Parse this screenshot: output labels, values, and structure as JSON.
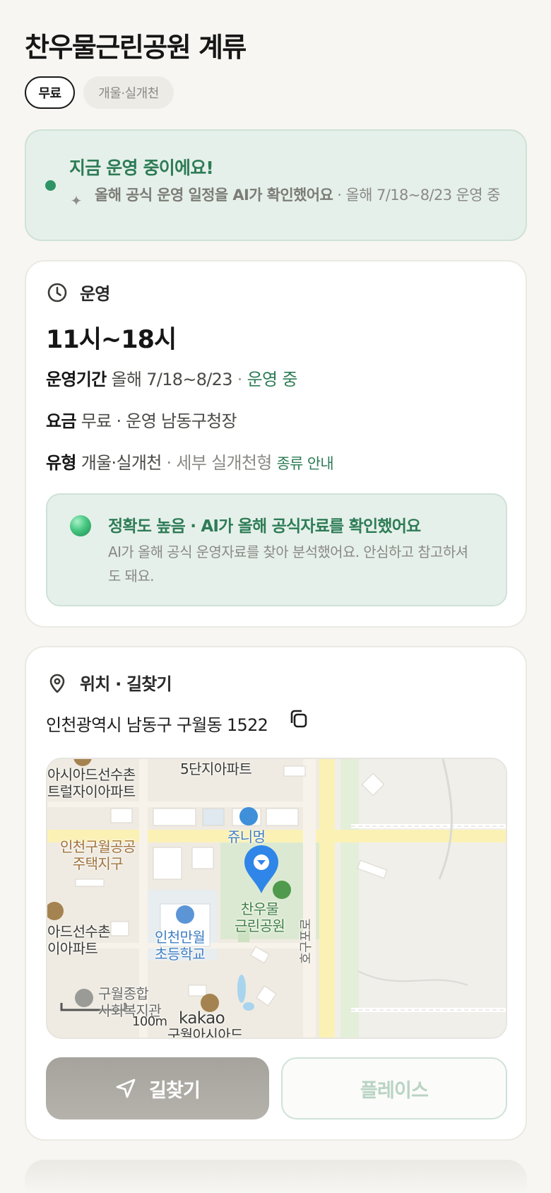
{
  "header": {
    "title": "찬우물근린공원 계류",
    "chips": {
      "price": "무료",
      "type": "개울·실개천"
    }
  },
  "status": {
    "title": "지금 운영 중이에요!",
    "ai_note": "올해 공식 운영 일정을 AI가 확인했어요",
    "period_note": " · 올해 7/18~8/23 운영 중",
    "icon": "sparkle-icon",
    "dot_color": "#2f9465"
  },
  "hours_section": {
    "heading": "운영",
    "icon": "clock-icon",
    "hours": "11시~18시",
    "period_key": "운영기간",
    "period_value": "올해 7/18~8/23",
    "period_sep": " · ",
    "period_status": "운영 중",
    "fee_key": "요금",
    "fee_value": "무료 · 운영 남동구청장",
    "type_key": "유형",
    "type_value": "개울·실개천",
    "type_detail": " · 세부 실개천형 ",
    "type_link": "종류 안내",
    "accuracy_title": "정확도 높음 · AI가 올해 공식자료를 확인했어요",
    "accuracy_desc": "AI가 올해 공식 운영자료를 찾아 분석했어요. 안심하고 참고하셔도 돼요."
  },
  "location_section": {
    "heading": "위치 · 길찾기",
    "icon": "location-pin-icon",
    "address": "인천광역시 남동구 구월동 1522",
    "copy_icon": "copy-icon",
    "map": {
      "labels": {
        "apt5": "5단지아파트",
        "asiad_top_1": "아시아드선수촌",
        "asiad_top_2": "트럴자이아파트",
        "incheon_public_1": "인천구월공공",
        "incheon_public_2": "주택지구",
        "junimung": "쥬니멍",
        "park_1": "찬우물",
        "park_2": "근린공원",
        "asiad_mid_1": "아드선수촌",
        "asiad_mid_2": "이아파트",
        "school_1": "인천만월",
        "school_2": "초등학교",
        "road": "호구포로",
        "welfare_1": "구월종합",
        "welfare_2": "사회복지관",
        "asiad_bottom": "구월아시아드",
        "scale": "100m",
        "brand": "kakao"
      }
    },
    "nav_button": "길찾기",
    "place_button": "플레이스"
  },
  "colors": {
    "accent_green": "#2d7c56",
    "status_bg": "#e6f0ea",
    "map_pin": "#2f86e8"
  }
}
